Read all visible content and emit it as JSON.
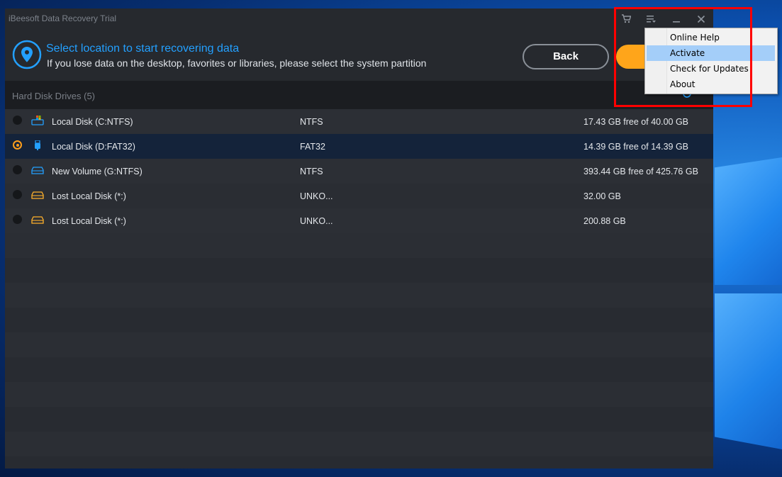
{
  "window": {
    "title": "iBeesoft Data Recovery Trial",
    "titlebar_icons": [
      "cart-icon",
      "menu-icon",
      "minimize-icon",
      "close-icon"
    ]
  },
  "header": {
    "title": "Select location to start recovering data",
    "subtitle": "If you lose data on the desktop, favorites or libraries, please select the system partition",
    "back_label": "Back",
    "accent_color": "#23a0ff",
    "primary_button_color": "#ffa51a"
  },
  "section": {
    "title": "Hard Disk Drives (5)"
  },
  "drives": [
    {
      "name": "Local Disk (C:NTFS)",
      "fs": "NTFS",
      "size": "17.43 GB free of 40.00 GB",
      "icon": "windows-drive-icon",
      "selected": false
    },
    {
      "name": "Local Disk (D:FAT32)",
      "fs": "FAT32",
      "size": "14.39 GB free of 14.39 GB",
      "icon": "usb-drive-icon",
      "selected": true
    },
    {
      "name": "New Volume (G:NTFS)",
      "fs": "NTFS",
      "size": "393.44 GB free of 425.76 GB",
      "icon": "hard-drive-icon",
      "selected": false
    },
    {
      "name": "Lost Local Disk (*:)",
      "fs": "UNKO...",
      "size": "32.00 GB",
      "icon": "lost-drive-icon",
      "selected": false
    },
    {
      "name": "Lost Local Disk (*:)",
      "fs": "UNKO...",
      "size": "200.88 GB",
      "icon": "lost-drive-icon",
      "selected": false
    }
  ],
  "menu": {
    "items": [
      {
        "label": "Online Help"
      },
      {
        "label": "Activate",
        "hovered": true
      },
      {
        "label": "Check for Updates"
      },
      {
        "label": "About"
      }
    ]
  }
}
